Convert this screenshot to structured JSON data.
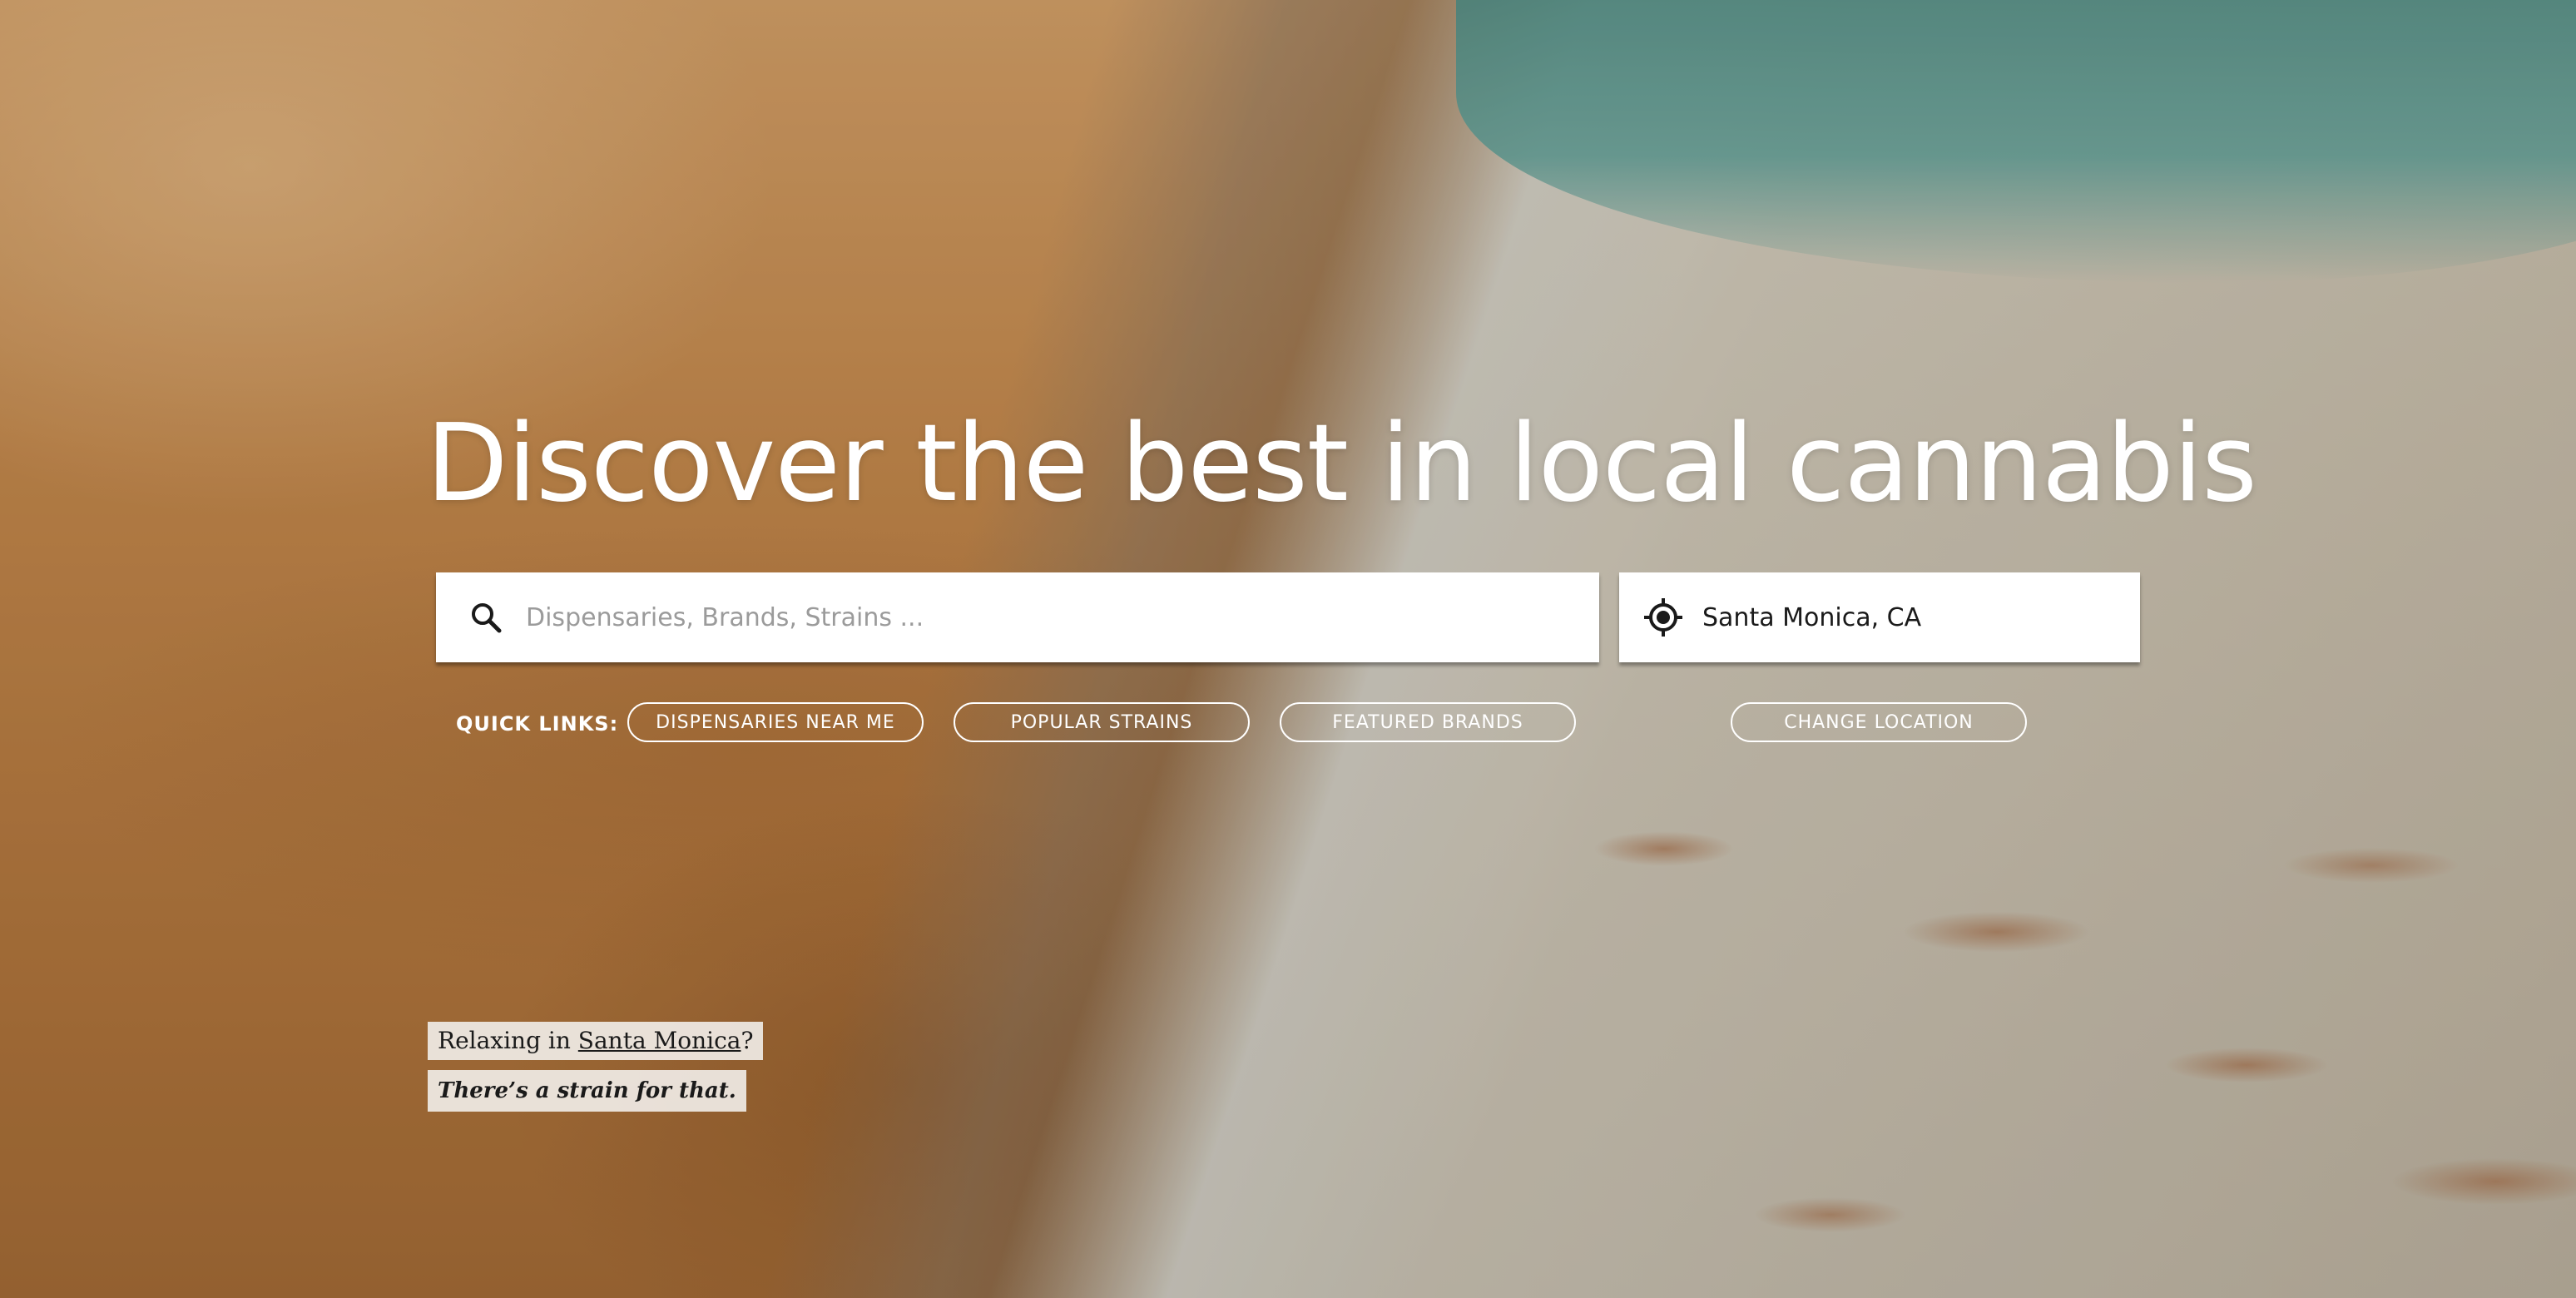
{
  "hero": {
    "background_image": "beach-surfer-photo",
    "headline": "Discover the best in local cannabis"
  },
  "search": {
    "placeholder": "Dispensaries, Brands, Strains ...",
    "value": "",
    "icon": "search-icon"
  },
  "location": {
    "value": "Santa Monica, CA",
    "icon": "crosshair-locate-icon"
  },
  "quick_links": {
    "label": "QUICK LINKS:",
    "items": [
      {
        "label": "DISPENSARIES NEAR ME"
      },
      {
        "label": "POPULAR STRAINS"
      },
      {
        "label": "FEATURED BRANDS"
      }
    ],
    "change_location": "CHANGE LOCATION"
  },
  "tagline": {
    "prefix": "Relaxing in ",
    "city": "Santa Monica",
    "suffix": "?",
    "subline": "There’s a strain for that."
  },
  "colors": {
    "text_on_hero": "#ffffff",
    "input_bg": "#ffffff",
    "placeholder": "#9b9b9b",
    "tagline_bg": "#f0ece6",
    "tagline_text": "#1a1a1a"
  }
}
